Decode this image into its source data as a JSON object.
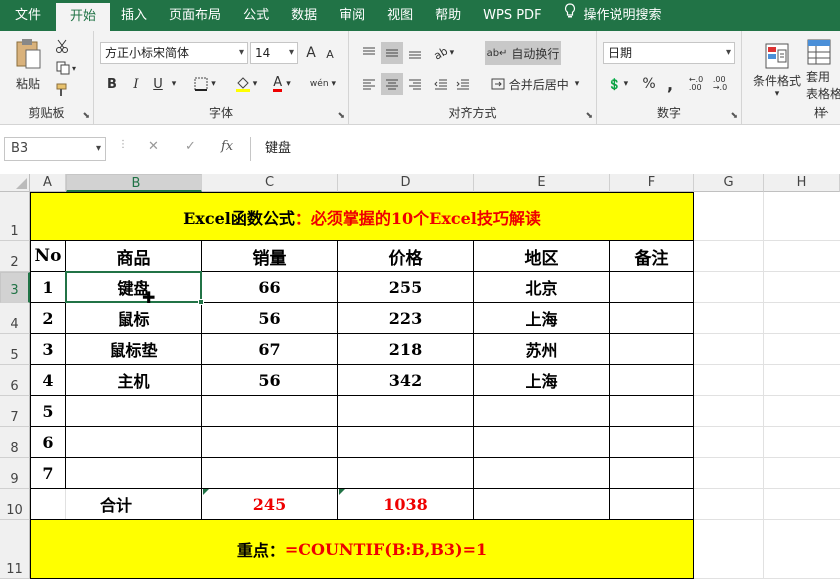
{
  "tabs": [
    "文件",
    "开始",
    "插入",
    "页面布局",
    "公式",
    "数据",
    "审阅",
    "视图",
    "帮助",
    "WPS PDF",
    "操作说明搜索"
  ],
  "ribbon": {
    "clipboard": {
      "paste": "粘贴",
      "label": "剪贴板"
    },
    "font": {
      "name": "方正小标宋简体",
      "size": "14",
      "bold": "B",
      "italic": "I",
      "underline": "U",
      "label": "字体",
      "grow": "A",
      "shrink": "A",
      "phonetic": "wén"
    },
    "alignment": {
      "wrap": "自动换行",
      "merge": "合并后居中",
      "label": "对齐方式"
    },
    "number": {
      "format": "日期",
      "percent": "%",
      "comma": ",",
      "label": "数字"
    },
    "styles": {
      "conditional": "条件格式",
      "table_line1": "套用",
      "table_line2": "表格格",
      "label": "样"
    }
  },
  "formula_bar": {
    "name_box": "B3",
    "fx": "fx",
    "content": "键盘"
  },
  "columns": [
    "A",
    "B",
    "C",
    "D",
    "E",
    "F",
    "G",
    "H"
  ],
  "rows": [
    "1",
    "2",
    "3",
    "4",
    "5",
    "6",
    "7",
    "8",
    "9",
    "10",
    "11"
  ],
  "sheet": {
    "title_black": "Excel函数公式",
    "title_red": "：必须掌握的10个Excel技巧解读",
    "headers": [
      "No",
      "商品",
      "销量",
      "价格",
      "地区",
      "备注"
    ],
    "data": [
      [
        "1",
        "键盘",
        "66",
        "255",
        "北京",
        ""
      ],
      [
        "2",
        "鼠标",
        "56",
        "223",
        "上海",
        ""
      ],
      [
        "3",
        "鼠标垫",
        "67",
        "218",
        "苏州",
        ""
      ],
      [
        "4",
        "主机",
        "56",
        "342",
        "上海",
        ""
      ],
      [
        "5",
        "",
        "",
        "",
        "",
        ""
      ],
      [
        "6",
        "",
        "",
        "",
        "",
        ""
      ],
      [
        "7",
        "",
        "",
        "",
        "",
        ""
      ]
    ],
    "total_label": "合计",
    "total_sales": "245",
    "total_price": "1038",
    "note_black": "重点：",
    "note_red": "=COUNTIF(B:B,B3)=1"
  }
}
